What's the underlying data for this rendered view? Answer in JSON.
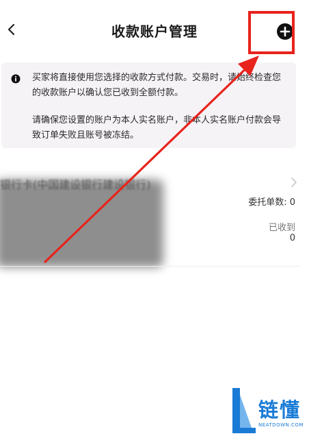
{
  "header": {
    "title": "收款账户管理",
    "back_icon": "chevron-left-icon",
    "add_icon": "plus-circle-icon"
  },
  "notice": {
    "icon": "info-icon",
    "paragraph1": "买家将直接使用您选择的收款方式付款。交易时，请始终检查您的收款账户以确认您已收到全额付款。",
    "paragraph2": "请确保您设置的账户为本人实名账户，非本人实名账户付款会导致订单失败且账号被冻结。"
  },
  "account": {
    "name": "银行卡(中国建设银行建设银行)",
    "stat1": "委托单数: 0",
    "stat2_label": "已收到",
    "stat2_value": "0"
  },
  "watermark": {
    "text": "链懂",
    "subtext": "NEATDOWN.COM"
  },
  "colors": {
    "accent_red": "#e8231b",
    "notice_bg": "#f6f3f7",
    "logo_blue": "#1a7bd6"
  }
}
